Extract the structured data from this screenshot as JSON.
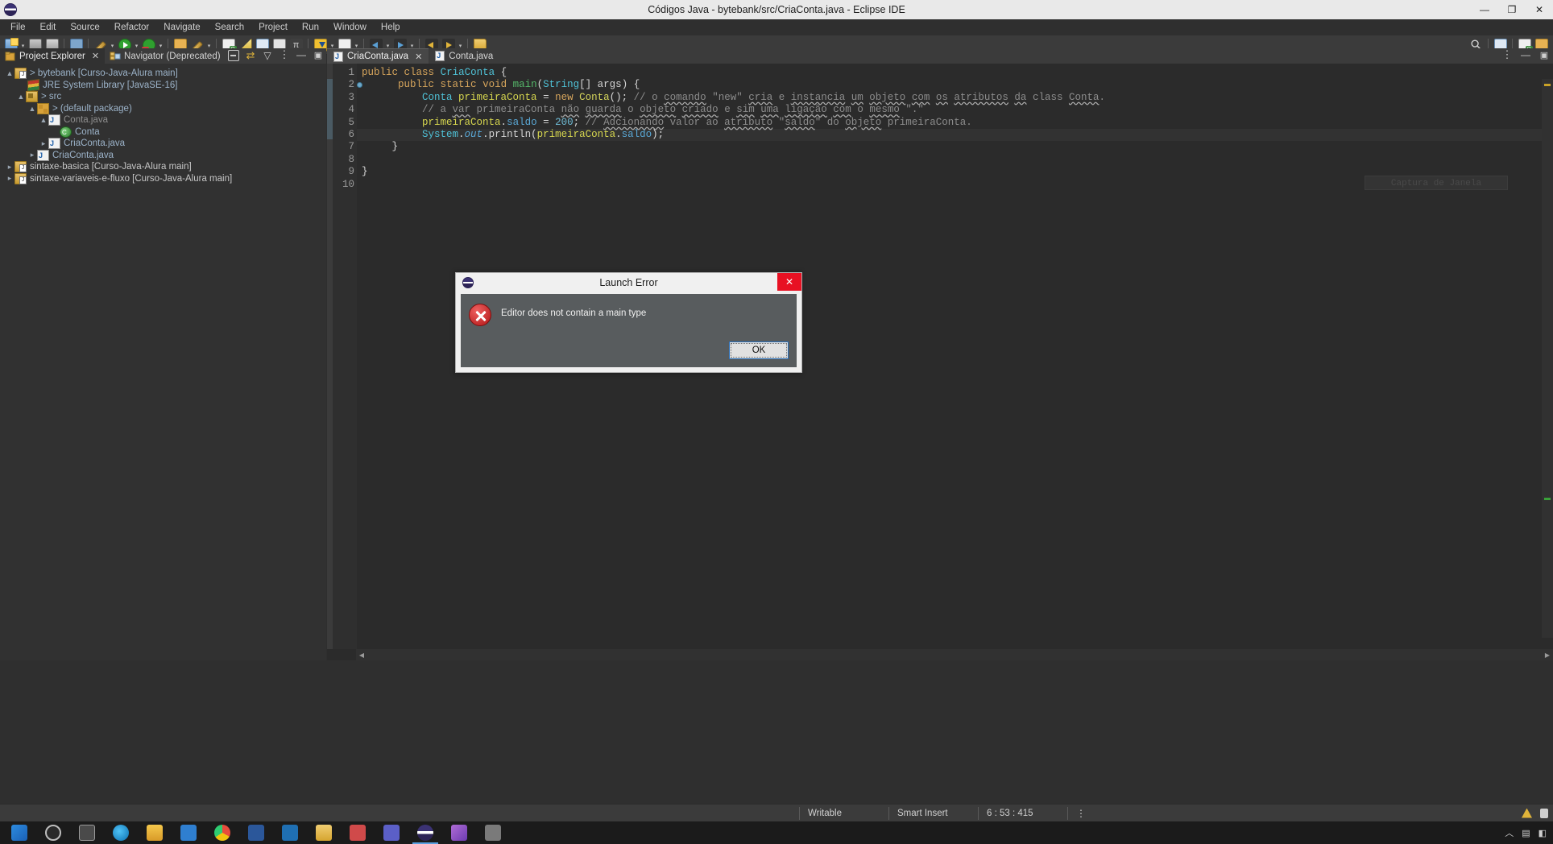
{
  "window": {
    "title": "Códigos Java - bytebank/src/CriaConta.java - Eclipse IDE",
    "minimize": "—",
    "maximize": "❐",
    "close": "✕"
  },
  "menu": {
    "items": [
      "File",
      "Edit",
      "Source",
      "Refactor",
      "Navigate",
      "Search",
      "Project",
      "Run",
      "Window",
      "Help"
    ]
  },
  "toolbar": {
    "icons": [
      "new-wizard-icon",
      "new-dropdown-icon",
      "save-icon",
      "save-all-icon",
      "print-icon",
      "debug-icon",
      "debug-dropdown-icon",
      "run-icon",
      "run-dropdown-icon",
      "run-error-icon",
      "run-error-dropdown-icon",
      "external-tools-icon",
      "external-tools-dropdown-icon",
      "new-java-class-icon",
      "new-java-project-icon",
      "new-package-icon",
      "new-annotation-icon",
      "pi-icon",
      "download-sources-icon",
      "download-dropdown-icon",
      "skip-breakpoints-icon",
      "skip-dropdown-icon",
      "back-icon",
      "forward-icon",
      "prev-annotation-icon",
      "next-annotation-icon",
      "last-edit-icon",
      "open-type-icon"
    ],
    "search_icon": "search-icon",
    "perspective_java_icon": "java-perspective-icon",
    "open_perspective_icon": "open-perspective-icon",
    "perspective_debug_icon": "debug-perspective-icon"
  },
  "left_panel": {
    "tabs": [
      {
        "label": "Project Explorer",
        "icon": "project-explorer-icon",
        "active": true,
        "closable": true
      },
      {
        "label": "Navigator (Deprecated)",
        "icon": "navigator-icon",
        "active": false,
        "closable": false
      }
    ],
    "close_glyph": "✕",
    "actions": [
      "collapse-all-icon",
      "link-with-editor-icon",
      "view-filter-icon",
      "view-menu-icon",
      "minimize-icon",
      "maximize-icon"
    ],
    "tree": [
      {
        "indent": 0,
        "twisty": "▲",
        "icon": "java-project-icon",
        "text": "> bytebank [Curso-Java-Alura main]",
        "style": "link"
      },
      {
        "indent": 1,
        "twisty": "",
        "icon": "jre-library-icon",
        "text": "JRE System Library [JavaSE-16]",
        "style": "link"
      },
      {
        "indent": 1,
        "twisty": "▲",
        "icon": "source-folder-icon",
        "text": "> src",
        "style": "link"
      },
      {
        "indent": 2,
        "twisty": "▲",
        "icon": "package-icon",
        "text": "> (default package)",
        "style": "link"
      },
      {
        "indent": 3,
        "twisty": "▲",
        "icon": "java-file-icon",
        "text": "Conta.java",
        "style": "dim"
      },
      {
        "indent": 4,
        "twisty": "",
        "icon": "java-class-icon",
        "text": "Conta",
        "style": "link"
      },
      {
        "indent": 3,
        "twisty": "▸",
        "icon": "java-file-icon",
        "text": "CriaConta.java",
        "style": "link"
      },
      {
        "indent": 2,
        "twisty": "▸",
        "icon": "java-file-icon",
        "text": "CriaConta.java",
        "style": "link"
      },
      {
        "indent": 0,
        "twisty": "▸",
        "icon": "java-project-icon",
        "text": "sintaxe-basica [Curso-Java-Alura main]",
        "style": "white"
      },
      {
        "indent": 0,
        "twisty": "▸",
        "icon": "java-project-icon",
        "text": "sintaxe-variaveis-e-fluxo [Curso-Java-Alura main]",
        "style": "white"
      }
    ]
  },
  "editor": {
    "tabs": [
      {
        "label": "CriaConta.java",
        "active": true,
        "closable": true
      },
      {
        "label": "Conta.java",
        "active": false,
        "closable": false
      }
    ],
    "close_glyph": "✕",
    "actions": [
      "view-menu-icon",
      "minimize-icon",
      "maximize-icon"
    ],
    "line_numbers": [
      "1",
      "2",
      "3",
      "4",
      "5",
      "6",
      "7",
      "8",
      "9",
      "10"
    ],
    "capture_ghost_text": "Captura de Janela",
    "lines": [
      {
        "n": 1,
        "current": false,
        "breakpoint": false,
        "text": "public class CriaConta {"
      },
      {
        "n": 2,
        "current": false,
        "breakpoint": true,
        "text": "     public static void main(String[] args) {"
      },
      {
        "n": 3,
        "current": false,
        "breakpoint": false,
        "text": "         Conta primeiraConta = new Conta(); // o comando \"new\" cria e instancia um objeto com os atributos da class Conta."
      },
      {
        "n": 4,
        "current": false,
        "breakpoint": false,
        "text": "         // a var primeiraConta não guarda o objeto criado e sim uma ligação com o mesmo \".\""
      },
      {
        "n": 5,
        "current": false,
        "breakpoint": false,
        "text": "         primeiraConta.saldo = 200; // Adcionando valor ao atributo \"saldo\" do objeto primeiraConta."
      },
      {
        "n": 6,
        "current": true,
        "breakpoint": false,
        "text": "         System.out.println(primeiraConta.saldo);"
      },
      {
        "n": 7,
        "current": false,
        "breakpoint": false,
        "text": "     }"
      },
      {
        "n": 8,
        "current": false,
        "breakpoint": false,
        "text": ""
      },
      {
        "n": 9,
        "current": false,
        "breakpoint": false,
        "text": "}"
      },
      {
        "n": 10,
        "current": false,
        "breakpoint": false,
        "text": ""
      }
    ]
  },
  "dialog": {
    "title": "Launch Error",
    "logo": "eclipse-logo-icon",
    "close_glyph": "✕",
    "message": "Editor does not contain a main type",
    "error_icon": "error-icon",
    "ok_label": "OK"
  },
  "statusbar": {
    "writable": "Writable",
    "insert_mode": "Smart Insert",
    "position": "6 : 53 : 415",
    "menu_glyph": "⋮",
    "warning_icon": "warning-icon",
    "pin_icon": "pin-icon"
  },
  "taskbar": {
    "items": [
      "start-icon",
      "search-icon",
      "task-view-icon",
      "edge-icon",
      "explorer-icon",
      "store-icon",
      "chrome-icon",
      "word-icon",
      "vscode-icon",
      "folder-icon",
      "media-icon",
      "teams-icon",
      "eclipse-icon",
      "paint-icon",
      "app-icon"
    ],
    "tray": [
      "tray-up-icon",
      "network-icon",
      "volume-icon"
    ]
  },
  "colors": {
    "accent": "#5aa0e0",
    "error": "#c0392b",
    "titlebar": "#e9e9e9",
    "editor_bg": "#2b2b2b",
    "panel_bg": "#313131"
  }
}
